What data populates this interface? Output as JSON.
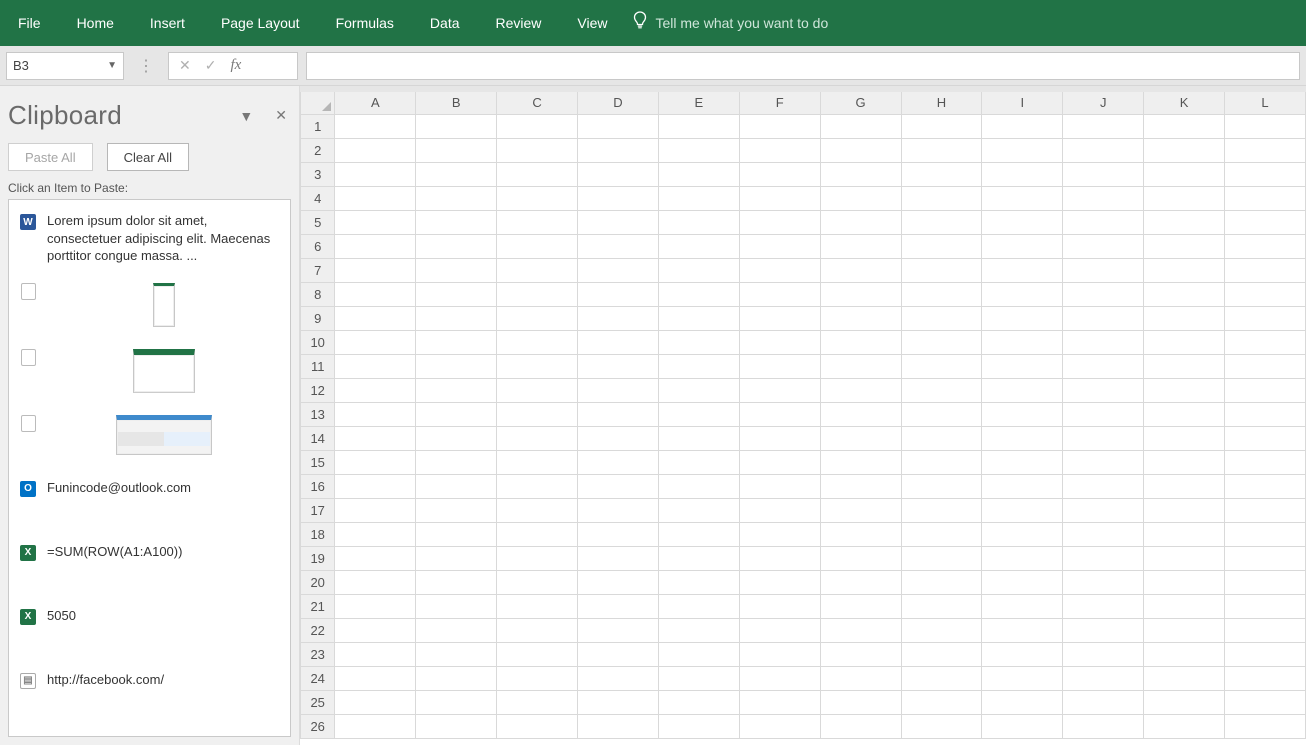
{
  "ribbon": {
    "tabs": [
      "File",
      "Home",
      "Insert",
      "Page Layout",
      "Formulas",
      "Data",
      "Review",
      "View"
    ],
    "tell_me": "Tell me what you want to do"
  },
  "namebox": {
    "value": "B3"
  },
  "formula_bar": {
    "value": ""
  },
  "clipboard": {
    "title": "Clipboard",
    "paste_all": "Paste All",
    "clear_all": "Clear All",
    "hint": "Click an Item to Paste:",
    "items": [
      {
        "icon": "word",
        "type": "text",
        "text": "Lorem ipsum dolor sit amet, consectetuer adipiscing elit. Maecenas porttitor congue massa. ..."
      },
      {
        "icon": "copy",
        "type": "image",
        "thumb": "a"
      },
      {
        "icon": "copy",
        "type": "image",
        "thumb": "b"
      },
      {
        "icon": "copy",
        "type": "image",
        "thumb": "c"
      },
      {
        "icon": "outlook",
        "type": "text",
        "text": "Funincode@outlook.com"
      },
      {
        "icon": "excel",
        "type": "text",
        "text": "=SUM(ROW(A1:A100))"
      },
      {
        "icon": "excel",
        "type": "text",
        "text": "5050"
      },
      {
        "icon": "web",
        "type": "text",
        "text": "http://facebook.com/"
      }
    ]
  },
  "grid": {
    "columns": [
      "A",
      "B",
      "C",
      "D",
      "E",
      "F",
      "G",
      "H",
      "I",
      "J",
      "K",
      "L"
    ],
    "row_count": 26
  }
}
